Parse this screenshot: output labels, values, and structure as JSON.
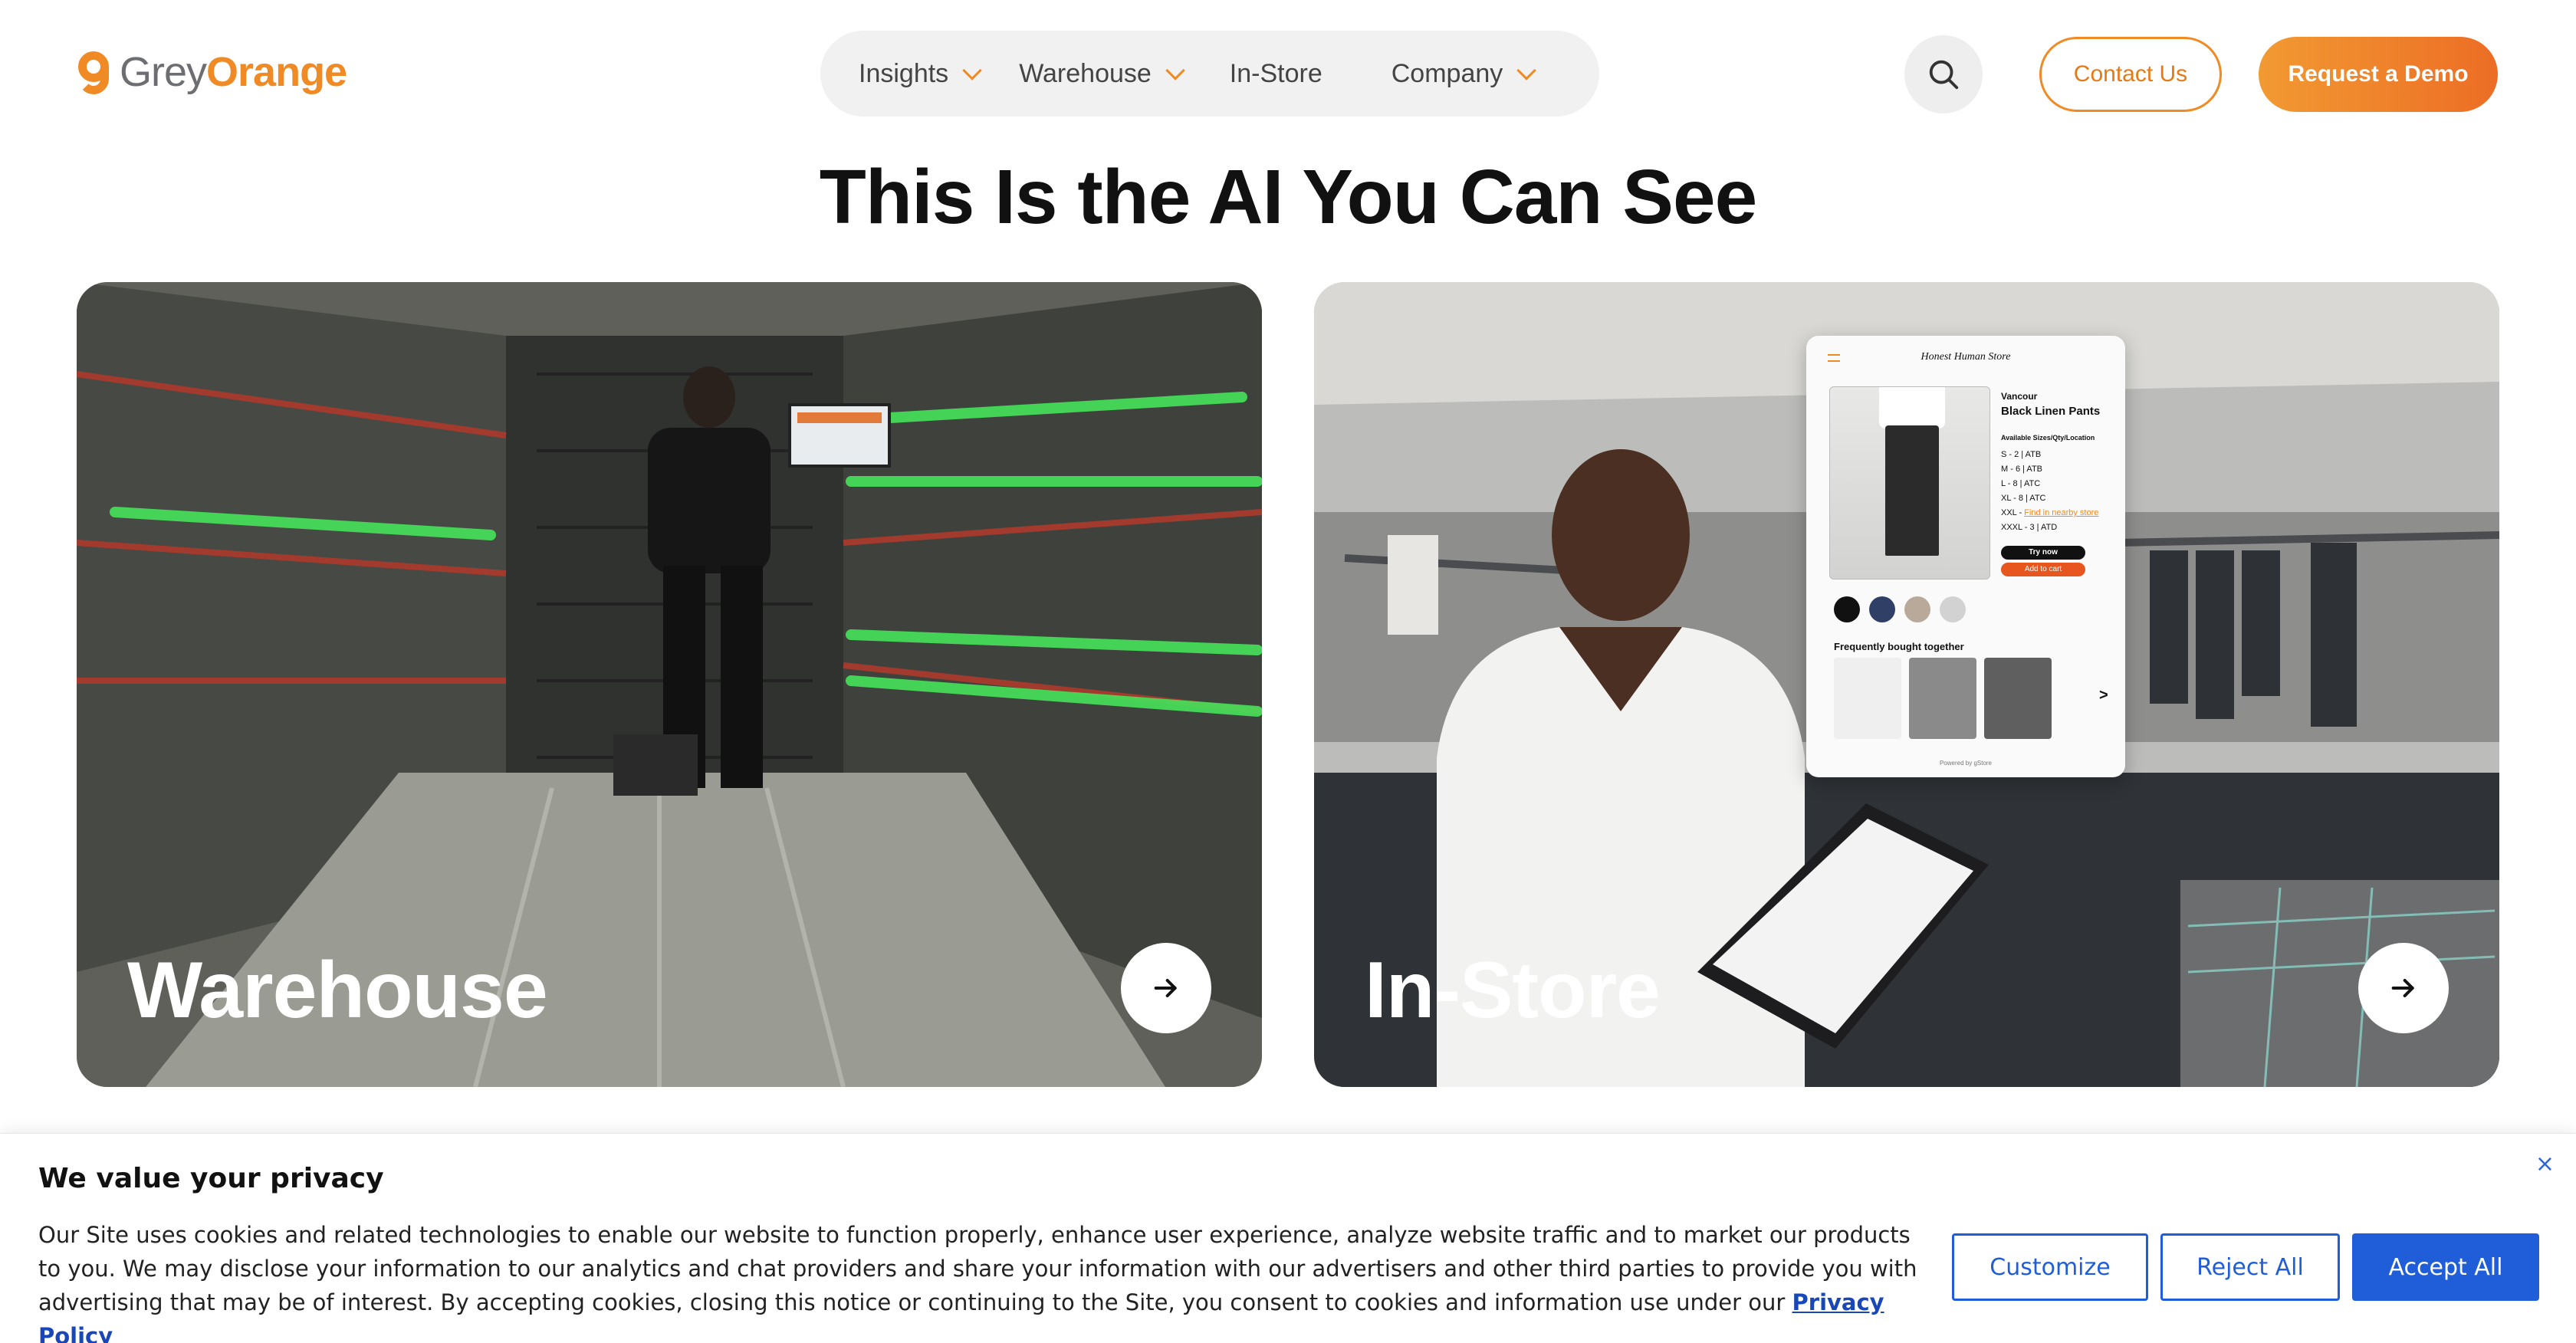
{
  "brand": {
    "logo_grey": "Grey",
    "logo_orange": "Orange",
    "accent_color": "#f08a24"
  },
  "nav": {
    "items": [
      {
        "label": "Insights",
        "has_dropdown": true
      },
      {
        "label": "Warehouse",
        "has_dropdown": true
      },
      {
        "label": "In-Store",
        "has_dropdown": false
      },
      {
        "label": "Company",
        "has_dropdown": true
      }
    ],
    "search_icon": "search-icon",
    "contact_label": "Contact Us",
    "demo_label": "Request a Demo"
  },
  "hero": {
    "title": "This Is the AI You Can See"
  },
  "cards": [
    {
      "label": "Warehouse",
      "icon": "arrow-right-icon"
    },
    {
      "label": "In-Store",
      "icon": "arrow-right-icon"
    }
  ],
  "instore_mock": {
    "store_name": "Honest Human Store",
    "brand": "Vancour",
    "product": "Black Linen Pants",
    "availability_label": "Available Sizes/Qty/Location",
    "sizes": [
      "S - 2 | ATB",
      "M - 6 | ATB",
      "L - 8 | ATC",
      "XL - 8 | ATC",
      "XXL - ",
      "XXXL - 3 | ATD"
    ],
    "nearby_link": "Find in nearby store",
    "try_now": "Try now",
    "add_to_cart": "Add to cart",
    "frequently_bought": "Frequently bought together",
    "next": ">",
    "powered_by": "Powered by gStore",
    "swatch_colors": [
      "#111111",
      "#2f3f66",
      "#b8a99a",
      "#d2d2d2"
    ]
  },
  "cookie": {
    "title": "We value your privacy",
    "text": "Our Site uses cookies and related technologies to enable our website to function properly, enhance user experience, analyze website traffic and to market our products to you. We may disclose your information to our analytics and chat providers and share your information with our advertisers and other third parties to provide you with advertising that may be of interest. By accepting cookies, closing this notice or continuing to the Site, you consent to cookies and information use under our",
    "privacy_link": "Privacy Policy",
    "close": "×",
    "customize_label": "Customize",
    "reject_label": "Reject All",
    "accept_label": "Accept All",
    "button_color": "#1f5ed8"
  }
}
